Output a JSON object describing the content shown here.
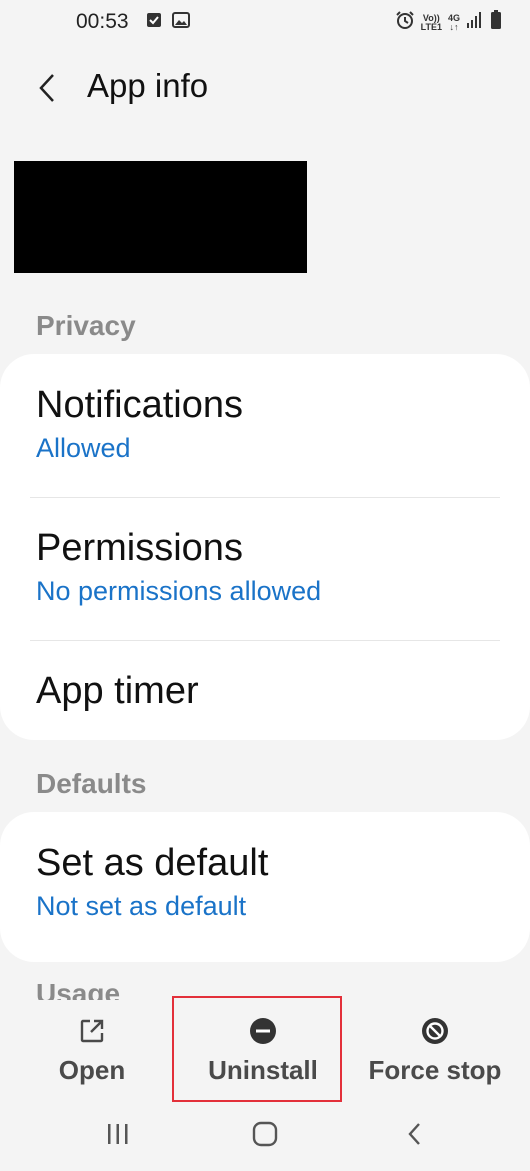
{
  "status_bar": {
    "time": "00:53",
    "network_top": "Vo))",
    "network_bottom": "LTE1",
    "net_type": "4G",
    "icons": [
      "check-box-icon",
      "image-icon",
      "alarm-icon",
      "signal-icon",
      "battery-icon"
    ]
  },
  "header": {
    "title": "App info"
  },
  "sections": {
    "privacy": "Privacy",
    "defaults": "Defaults",
    "usage": "Usage"
  },
  "privacy_items": [
    {
      "title": "Notifications",
      "subtitle": "Allowed"
    },
    {
      "title": "Permissions",
      "subtitle": "No permissions allowed"
    },
    {
      "title": "App timer",
      "subtitle": ""
    }
  ],
  "defaults_items": [
    {
      "title": "Set as default",
      "subtitle": "Not set as default"
    }
  ],
  "actions": {
    "open": "Open",
    "uninstall": "Uninstall",
    "force_stop": "Force stop"
  },
  "colors": {
    "accent": "#1a73c8",
    "highlight": "#e3303a",
    "background": "#f4f4f4"
  }
}
